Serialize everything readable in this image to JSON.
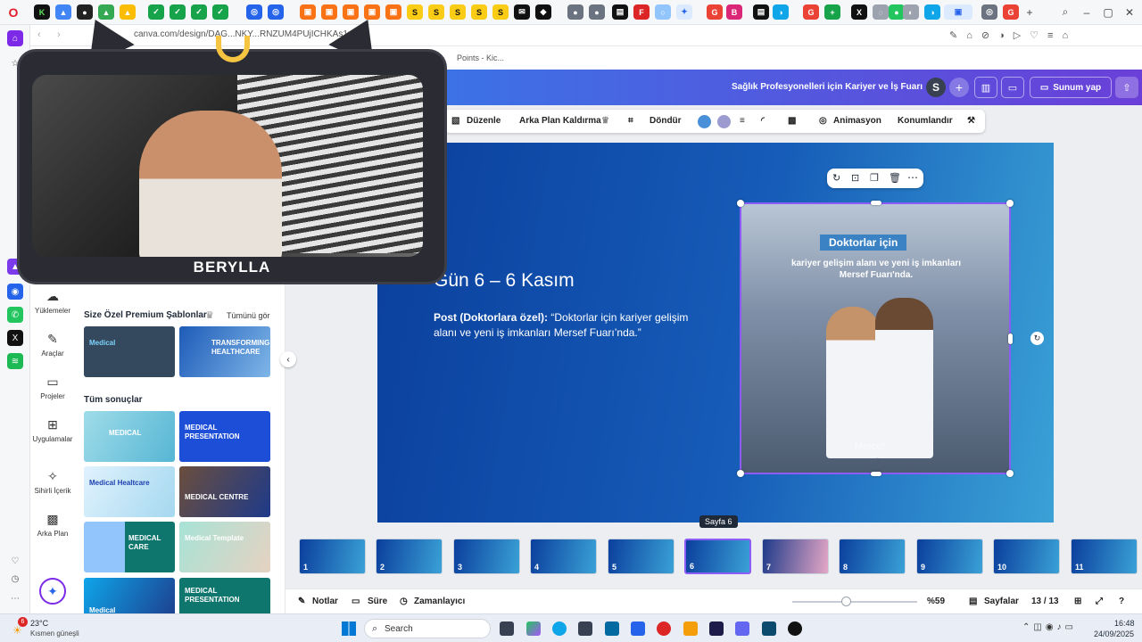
{
  "browser": {
    "url": "canva.com/design/DAG...NKY...RNZUM4PUjICHKAs1ur...",
    "crumb": "Points - Kic..."
  },
  "canva": {
    "design_title": "Sağlık Profesyonelleri için Kariyer ve İş Fuarı",
    "avatar_letter": "S",
    "present_label": "Sunum yap",
    "rail": [
      "Yüklemeler",
      "Araçlar",
      "Projeler",
      "Uygulamalar",
      "Sihirli İçerik",
      "Arka Plan"
    ],
    "panel": {
      "premium_title": "Size Özel Premium Şablonlar",
      "see_all": "Tümünü gör",
      "all_results": "Tüm sonuçlar",
      "thumbs": [
        "Medical",
        "TRANSFORMING HEALTHCARE",
        "MEDICAL",
        "MEDICAL PRESENTATION",
        "Medical Healtcare",
        "MEDICAL CENTRE",
        "MEDICAL CARE",
        "Medical Template",
        "Medical",
        "MEDICAL PRESENTATION"
      ]
    },
    "toolbar": {
      "edit": "Düzenle",
      "bg_remove": "Arka Plan Kaldırma",
      "rotate": "Döndür",
      "animation": "Animasyon",
      "position": "Konumlandır"
    },
    "slide": {
      "heading": "Gün 6 – 6 Kasım",
      "post_label": "Post (Doktorlara özel):",
      "post_text": "“Doktorlar için kariyer gelişim alanı ve yeni iş imkanları Mersef Fuarı’nda.”",
      "photo_badge": "Doktorlar için",
      "photo_line": "kariyer gelişim alanı ve yeni iş imkanları Mersef Fuarı'nda.",
      "photo_brand": "Mercef"
    },
    "tooltip": "Sayfa 6",
    "pages": [
      "1",
      "2",
      "3",
      "4",
      "5",
      "6",
      "7",
      "8",
      "9",
      "10",
      "11"
    ],
    "bottom": {
      "notes": "Notlar",
      "duration": "Süre",
      "timer": "Zamanlayıcı",
      "zoom": "%59",
      "pages_label": "Sayfalar",
      "page_count": "13 / 13"
    }
  },
  "webcam": {
    "name": "BERYLLA"
  },
  "taskbar": {
    "temp": "23°C",
    "weather": "Kısmen güneşli",
    "search": "Search",
    "time": "16:48",
    "date": "24/09/2025",
    "badge": "6"
  },
  "colors": {
    "canva_purple": "#7d2ae8",
    "slide_blue": "#0b3f9d",
    "selection": "#8b5cf6"
  }
}
